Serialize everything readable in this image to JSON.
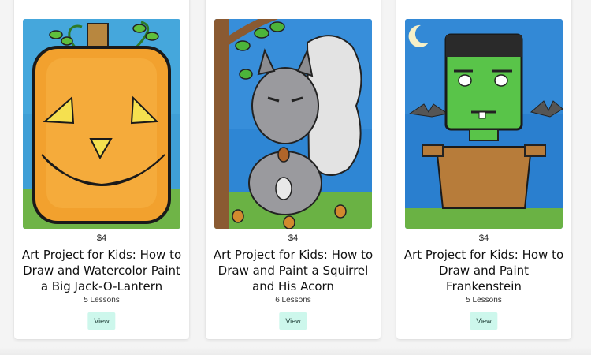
{
  "products": [
    {
      "price": "$4",
      "title": "Art Project for Kids: How to Draw and Watercolor Paint a Big Jack-O-Lantern",
      "lessons": "5 Lessons",
      "view_label": "View",
      "image_icon": "jack-o-lantern-painting"
    },
    {
      "price": "$4",
      "title": "Art Project for Kids: How to Draw and Paint a Squirrel and His Acorn",
      "lessons": "6 Lessons",
      "view_label": "View",
      "image_icon": "squirrel-painting"
    },
    {
      "price": "$4",
      "title": "Art Project for Kids: How to Draw and Paint Frankenstein",
      "lessons": "5 Lessons",
      "view_label": "View",
      "image_icon": "frankenstein-painting"
    }
  ],
  "colors": {
    "button_bg": "#cdf7ec",
    "card_bg": "#ffffff",
    "page_bg": "#f4f4f4"
  }
}
